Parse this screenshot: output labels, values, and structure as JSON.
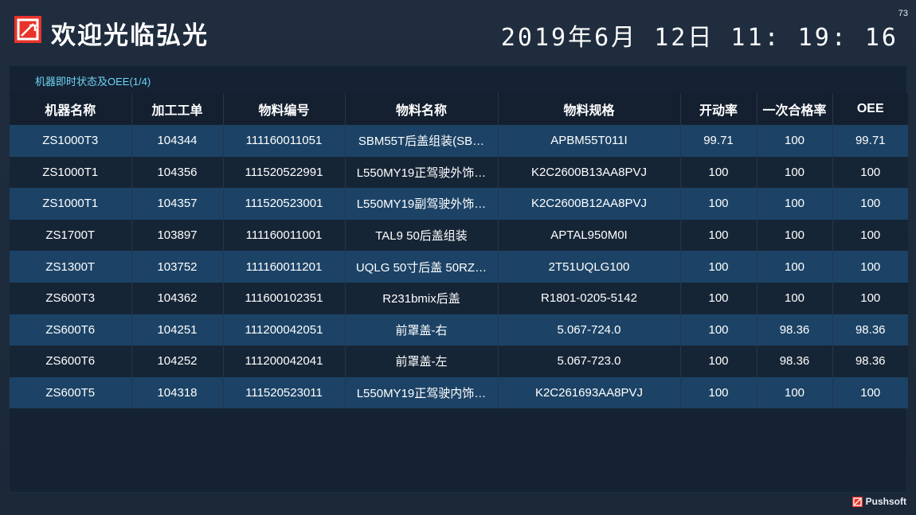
{
  "header": {
    "title": "欢迎光临弘光",
    "clock": "2019年6月 12日 11: 19: 16",
    "corner_number": "73",
    "logo_icon": "brand-logo-icon",
    "accent_color": "#e8332a"
  },
  "panel": {
    "title": "机器即时状态及OEE(1/4)"
  },
  "table": {
    "columns": [
      "机器名称",
      "加工工单",
      "物料编号",
      "物料名称",
      "物料规格",
      "开动率",
      "一次合格率",
      "OEE"
    ],
    "rows": [
      [
        "ZS1000T3",
        "104344",
        "111160011051",
        "SBM55T后盖组装(SB…",
        "APBM55T011I",
        "99.71",
        "100",
        "99.71"
      ],
      [
        "ZS1000T1",
        "104356",
        "111520522991",
        "L550MY19正驾驶外饰…",
        "K2C2600B13AA8PVJ",
        "100",
        "100",
        "100"
      ],
      [
        "ZS1000T1",
        "104357",
        "111520523001",
        "L550MY19副驾驶外饰…",
        "K2C2600B12AA8PVJ",
        "100",
        "100",
        "100"
      ],
      [
        "ZS1700T",
        "103897",
        "111160011001",
        "TAL9 50后盖组装",
        "APTAL950M0I",
        "100",
        "100",
        "100"
      ],
      [
        "ZS1300T",
        "103752",
        "111160011201",
        "UQLG 50寸后盖 50RZ…",
        "2T51UQLG100",
        "100",
        "100",
        "100"
      ],
      [
        "ZS600T3",
        "104362",
        "111600102351",
        "R231bmix后盖",
        "R1801-0205-5142",
        "100",
        "100",
        "100"
      ],
      [
        "ZS600T6",
        "104251",
        "111200042051",
        "前罩盖-右",
        "5.067-724.0",
        "100",
        "98.36",
        "98.36"
      ],
      [
        "ZS600T6",
        "104252",
        "111200042041",
        "前罩盖-左",
        "5.067-723.0",
        "100",
        "98.36",
        "98.36"
      ],
      [
        "ZS600T5",
        "104318",
        "111520523011",
        "L550MY19正驾驶内饰…",
        "K2C261693AA8PVJ",
        "100",
        "100",
        "100"
      ]
    ]
  },
  "footer": {
    "brand": "Pushsoft"
  }
}
